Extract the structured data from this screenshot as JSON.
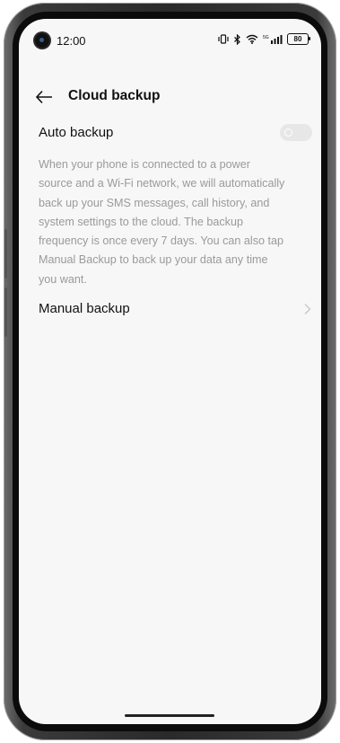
{
  "status_bar": {
    "time": "12:00",
    "battery": "80"
  },
  "header": {
    "title": "Cloud backup"
  },
  "auto_backup": {
    "label": "Auto backup",
    "enabled": false,
    "description": "When your phone is connected to a power source and a Wi-Fi network, we will automatically back up your SMS messages, call history, and system settings to the cloud. The backup frequency is once every 7 days. You can also tap Manual Backup to back up your data any time you want."
  },
  "manual_backup": {
    "label": "Manual backup"
  },
  "icons": {
    "back": "back-arrow-icon",
    "chevron": "chevron-right-icon",
    "vibrate": "vibrate-icon",
    "bluetooth": "bluetooth-icon",
    "wifi": "wifi-icon",
    "signal": "signal-icon"
  },
  "colors": {
    "screen_bg": "#f7f7f7",
    "text_primary": "#111111",
    "text_secondary": "#9a9a9a",
    "toggle_off": "#e7e7e7"
  }
}
